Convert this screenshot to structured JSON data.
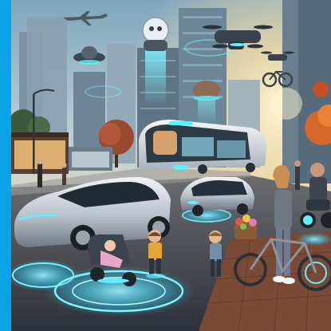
{
  "image": {
    "description_free": true,
    "colors": {
      "frame_accent": "#0aa3e8",
      "sky_top": "#8fb5c9",
      "sky_glow": "#f4d8a6",
      "sun": "#ffe9b8",
      "tower_dark": "#5d6f7e",
      "tower_light": "#8ca4b5",
      "holo_cyan": "#37e3ff",
      "road": "#3a3f47",
      "sidewalk": "#8a5a45",
      "car_silver": "#c9cfd6",
      "autumn_tree": "#c9552a"
    }
  }
}
